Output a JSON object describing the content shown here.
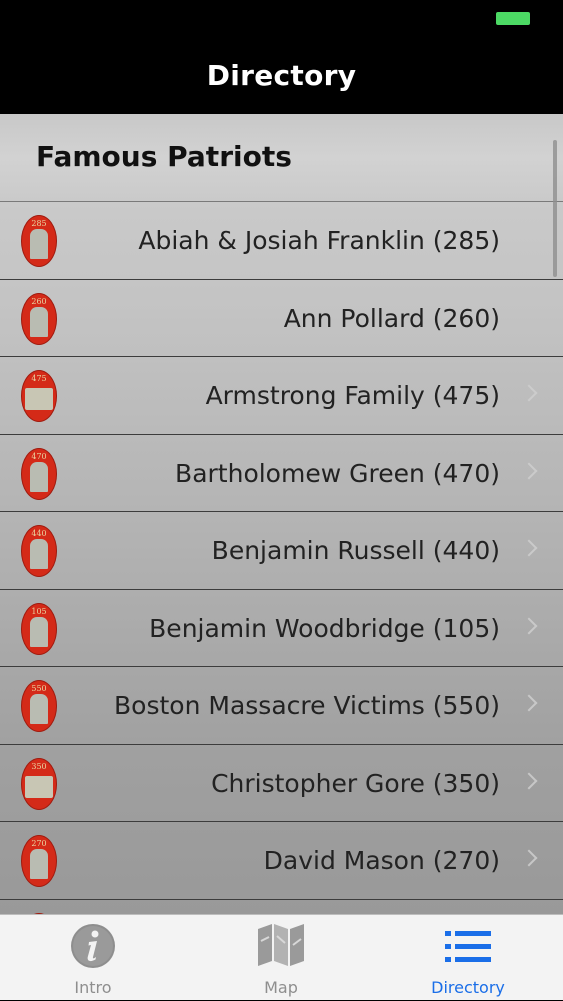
{
  "nav": {
    "title": "Directory"
  },
  "section": {
    "title": "Famous Patriots"
  },
  "rows": [
    {
      "label": "Abiah & Josiah Franklin (285)",
      "thumb": "285"
    },
    {
      "label": "Ann Pollard (260)",
      "thumb": "260"
    },
    {
      "label": "Armstrong Family (475)",
      "thumb": "475"
    },
    {
      "label": "Bartholomew Green (470)",
      "thumb": "470"
    },
    {
      "label": "Benjamin Russell (440)",
      "thumb": "440"
    },
    {
      "label": "Benjamin Woodbridge (105)",
      "thumb": "105"
    },
    {
      "label": "Boston Massacre Victims (550)",
      "thumb": "550"
    },
    {
      "label": "Christopher Gore (350)",
      "thumb": "350"
    },
    {
      "label": "David Mason (270)",
      "thumb": "270"
    },
    {
      "label": "",
      "thumb": ""
    }
  ],
  "tabs": [
    {
      "label": "Intro",
      "icon": "info-icon"
    },
    {
      "label": "Map",
      "icon": "map-icon"
    },
    {
      "label": "Directory",
      "icon": "list-icon"
    }
  ],
  "colors": {
    "accent": "#1a6ee8",
    "battery": "#4cd964",
    "thumbnail": "#d42a18",
    "tab_inactive": "#8e8e8e"
  }
}
